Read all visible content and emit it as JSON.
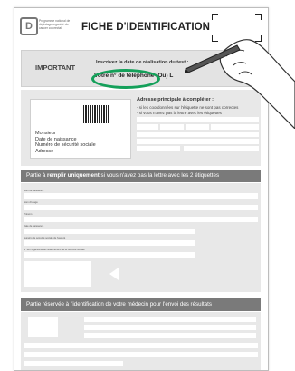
{
  "logo": {
    "mark": "D",
    "text": "Programme national de dépistage organisé du cancer colorectal"
  },
  "header": {
    "title": "FICHE D'IDENTIFICATION"
  },
  "important": {
    "label": "IMPORTANT",
    "line1": "Inscrivez la date de réalisation du test :",
    "line2": "Votre n° de téléphone (Ou) L"
  },
  "label_card": {
    "lines": [
      "Monsieur",
      "Date de naissance",
      "Numéro de sécurité sociale",
      "Adresse"
    ]
  },
  "address": {
    "title": "Adresse principale à compléter :",
    "notes": [
      "- si les coordonnées sur l'étiquette ne sont pas correctes",
      "- si vous n'avez pas la lettre avec les étiquettes"
    ]
  },
  "section1": {
    "prefix": "Partie à ",
    "bold": "remplir uniquement",
    "suffix": " si vous n'avez pas la lettre avec les 2 étiquettes",
    "fields": [
      "Nom de naissance",
      "Nom d'usage",
      "Prénom",
      "Date de naissance",
      "Numéro de sécurité sociale de l'assuré",
      "N° de l'organisme de rattachement de la Sécurité sociale"
    ]
  },
  "section2": {
    "title": "Partie réservée à l'identification de votre médecin pour l'envoi des résultats"
  },
  "colors": {
    "band": "#7a7a7a",
    "panel": "#e8e8e8",
    "highlight_oval": "#14a05a"
  },
  "icons": {
    "hand": "hand-writing-with-pen-icon",
    "arrow": "arrow-left-icon"
  }
}
